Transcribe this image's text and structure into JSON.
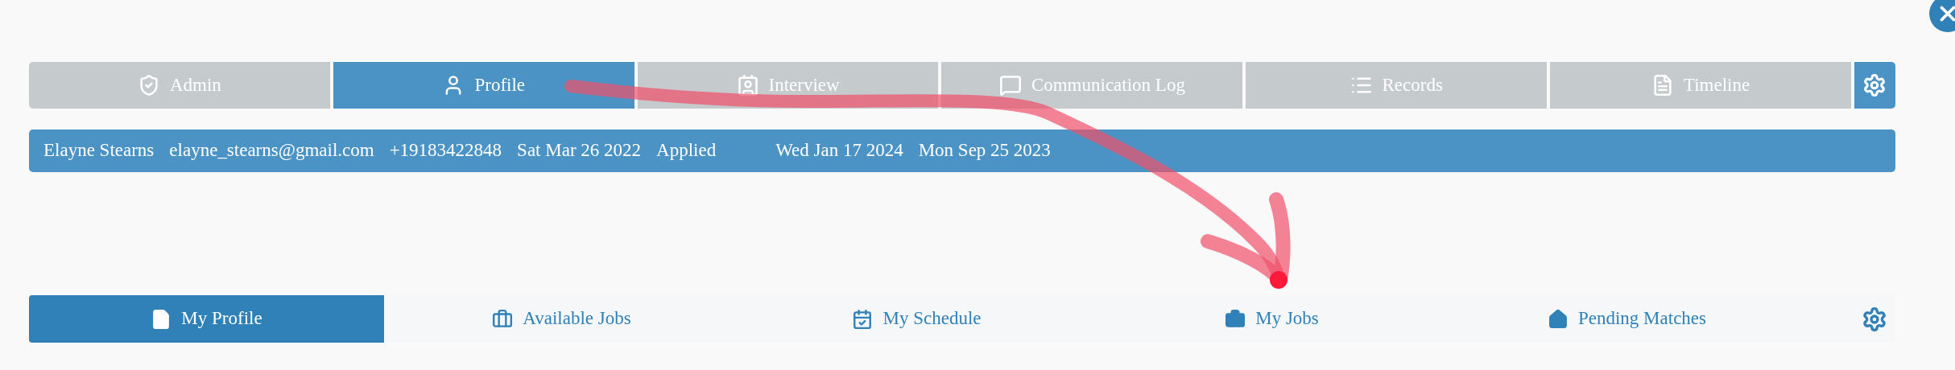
{
  "top_tabs": [
    {
      "label": "Admin",
      "selected": false
    },
    {
      "label": "Profile",
      "selected": true
    },
    {
      "label": "Interview",
      "selected": false
    },
    {
      "label": "Communication Log",
      "selected": false
    },
    {
      "label": "Records",
      "selected": false
    },
    {
      "label": "Timeline",
      "selected": false
    }
  ],
  "info_bar": [
    "Elayne Stearns",
    "elayne_stearns@gmail.com",
    "+19183422848",
    "Sat Mar 26 2022",
    "Applied",
    "Wed Jan 17 2024",
    "Mon Sep 25 2023"
  ],
  "bottom_tabs": [
    {
      "label": "My Profile",
      "selected": true
    },
    {
      "label": "Available Jobs",
      "selected": false
    },
    {
      "label": "My Schedule",
      "selected": false
    },
    {
      "label": "My Jobs",
      "selected": false
    },
    {
      "label": "Pending Matches",
      "selected": false
    }
  ]
}
